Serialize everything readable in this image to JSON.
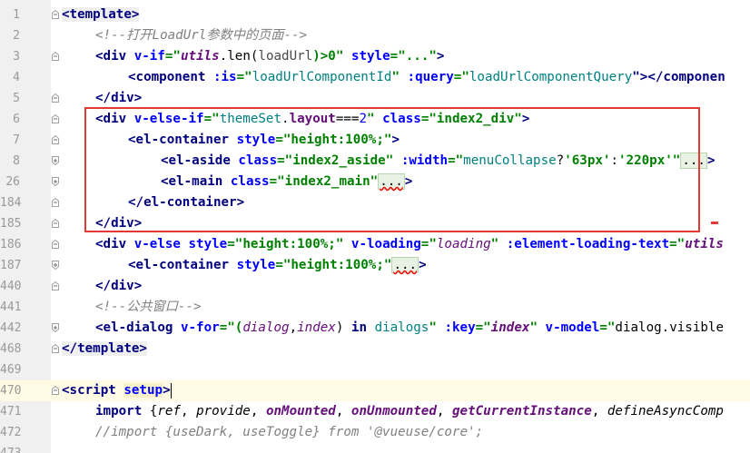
{
  "editor": {
    "lines": [
      {
        "num": "1",
        "fold": "minus"
      },
      {
        "num": "2",
        "fold": "none"
      },
      {
        "num": "3",
        "fold": "minus"
      },
      {
        "num": "4",
        "fold": "none"
      },
      {
        "num": "5",
        "fold": "minus"
      },
      {
        "num": "6",
        "fold": "minus"
      },
      {
        "num": "7",
        "fold": "minus"
      },
      {
        "num": "8",
        "fold": "plus"
      },
      {
        "num": "26",
        "fold": "plus"
      },
      {
        "num": "184",
        "fold": "minus"
      },
      {
        "num": "185",
        "fold": "minus"
      },
      {
        "num": "186",
        "fold": "minus"
      },
      {
        "num": "187",
        "fold": "plus"
      },
      {
        "num": "440",
        "fold": "minus"
      },
      {
        "num": "441",
        "fold": "none"
      },
      {
        "num": "442",
        "fold": "plus"
      },
      {
        "num": "468",
        "fold": "minus"
      },
      {
        "num": "469",
        "fold": "none"
      },
      {
        "num": "470",
        "fold": "minus"
      },
      {
        "num": "471",
        "fold": "none"
      },
      {
        "num": "472",
        "fold": "none"
      },
      {
        "num": "473",
        "fold": "none"
      }
    ]
  },
  "code": {
    "l1_tag": "<template>",
    "l2_comment": "<!--打开LoadUrl参数中的页面-->",
    "l3_open": "<div ",
    "l3_attr": "v-if",
    "l3_eq": "=\"",
    "l3_var": "utils",
    "l3_mid": ".len(",
    "l3_var2": "loadUrl",
    "l3_end": ")>0\" ",
    "l3_attr2": "style",
    "l3_val2": "=\"...\"",
    "l3_close": ">",
    "l4_open": "<component ",
    "l4_attr": ":is",
    "l4_eq": "=\"",
    "l4_val": "loadUrlComponentId",
    "l4_q": "\" ",
    "l4_attr2": ":query",
    "l4_eq2": "=\"",
    "l4_val2": "loadUrlComponentQuery",
    "l4_end": "\"></componen",
    "l5_tag": "</div>",
    "l6_open": "<div ",
    "l6_attr": "v-else-if",
    "l6_eq": "=\"",
    "l6_v1": "themeSet",
    "l6_dot": ".",
    "l6_v2": "layout",
    "l6_op": "===",
    "l6_num": "2",
    "l6_q": "\" ",
    "l6_attr2": "class",
    "l6_val2": "=\"index2_div\"",
    "l6_close": ">",
    "l7_open": "<el-container ",
    "l7_attr": "style",
    "l7_val": "=\"height:100%;\"",
    "l7_close": ">",
    "l8_open": "<el-aside ",
    "l8_attr": "class",
    "l8_val": "=\"index2_aside\" ",
    "l8_attr2": ":width",
    "l8_eq": "=\"",
    "l8_expr": "menuCollapse",
    "l8_q": "?",
    "l8_s1": "'63px'",
    "l8_c": ":",
    "l8_s2": "'220px'",
    "l8_endq": "\"",
    "l8_ell": "...",
    "l8_close": ">",
    "l26_open": "<el-main ",
    "l26_attr": "class",
    "l26_val": "=\"index2_main\"",
    "l26_ell": "...",
    "l26_close": ">",
    "l184_tag": "</el-container>",
    "l185_tag": "</div>",
    "l186_open": "<div ",
    "l186_attr": "v-else ",
    "l186_attr2": "style",
    "l186_val": "=\"height:100%;\" ",
    "l186_attr3": "v-loading",
    "l186_eq": "=\"",
    "l186_var": "loading",
    "l186_q": "\" ",
    "l186_attr4": ":element-loading-text",
    "l186_eq2": "=\"",
    "l186_end": "utils",
    "l187_open": "<el-container ",
    "l187_attr": "style",
    "l187_val": "=\"height:100%;\"",
    "l187_ell": "...",
    "l187_close": ">",
    "l440_tag": "</div>",
    "l441_comment": "<!--公共窗口-->",
    "l442_open": "<el-dialog ",
    "l442_attr": "v-for",
    "l442_eq": "=\"(",
    "l442_v1": "dialog",
    "l442_comma": ",",
    "l442_v2": "index",
    "l442_in": ") ",
    "l442_kw": "in",
    "l442_sp": " ",
    "l442_v3": "dialogs",
    "l442_q": "\" ",
    "l442_attr2": ":key",
    "l442_eq2": "=\"",
    "l442_v4": "index",
    "l442_q2": "\" ",
    "l442_attr3": "v-model",
    "l442_eq3": "=\"",
    "l442_end": "dialog.visible",
    "l468_tag": "</template>",
    "l470_open": "<script ",
    "l470_attr": "setup",
    "l470_close": ">",
    "l471_kw": "import",
    "l471_b1": " {",
    "l471_f1": "ref",
    "l471_c1": ", ",
    "l471_f2": "provide",
    "l471_c2": ", ",
    "l471_f3": "onMounted",
    "l471_c3": ", ",
    "l471_f4": "onUnmounted",
    "l471_c4": ", ",
    "l471_f5": "getCurrentInstance",
    "l471_c5": ", ",
    "l471_f6": "defineAsyncComp",
    "l472_comment": "//import {useDark, useToggle} from '@vueuse/core';"
  },
  "colors": {
    "highlight_border": "#e53935",
    "tag": "#000080",
    "attribute": "#0000ff",
    "string": "#008000",
    "comment": "#808080",
    "gutter_bg": "#f0f0f0",
    "current_line": "#fffae3"
  }
}
